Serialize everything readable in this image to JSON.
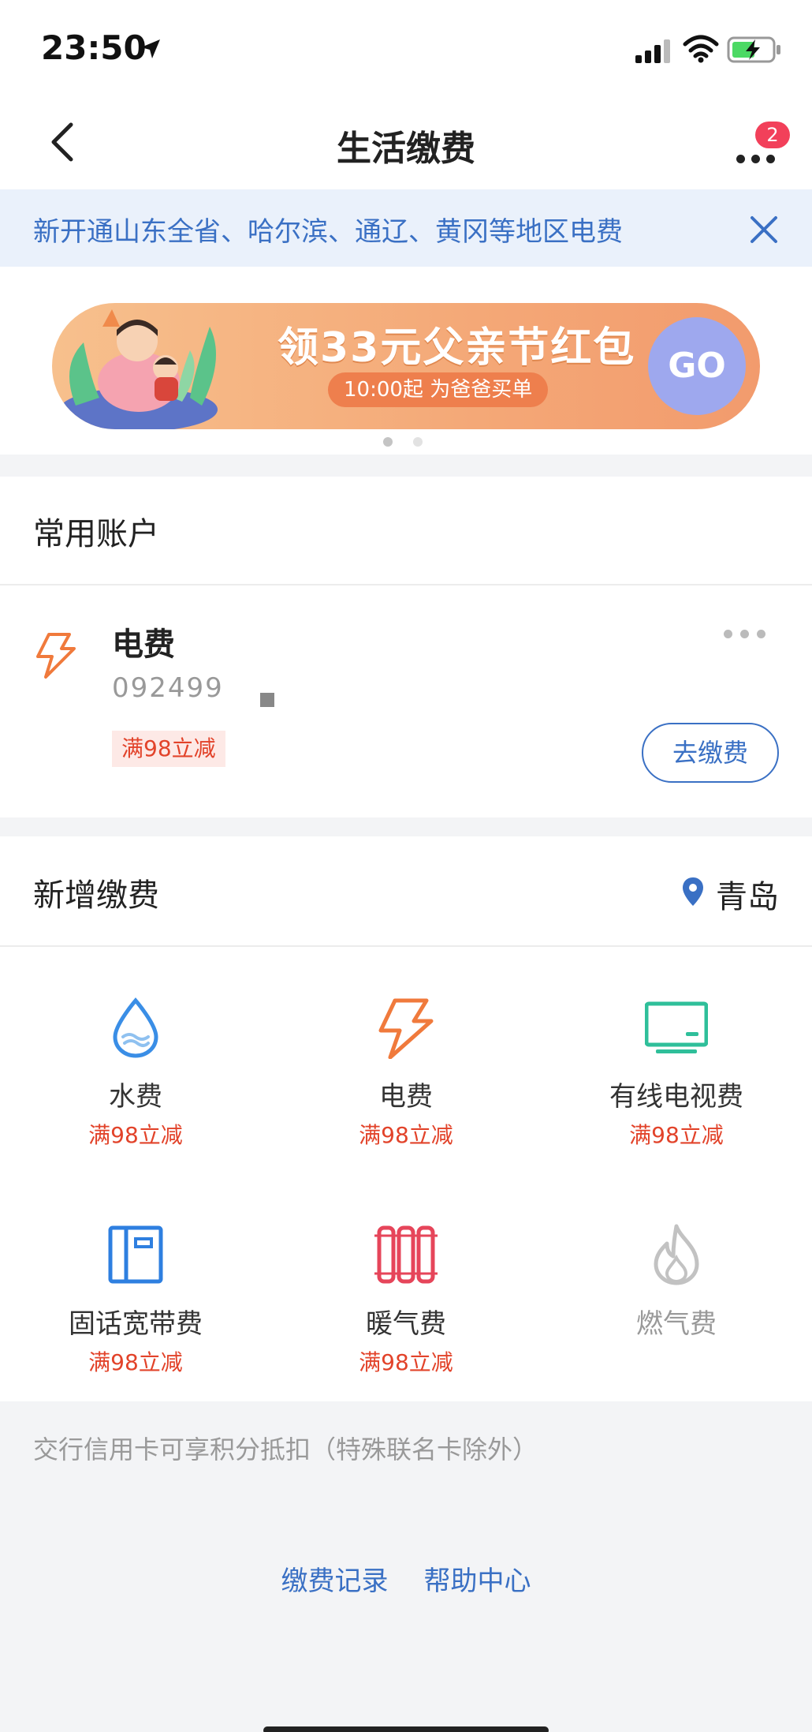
{
  "status_bar": {
    "time": "23:50",
    "icons": [
      "location-arrow-icon",
      "signal-icon",
      "wifi-icon",
      "battery-charging-icon"
    ]
  },
  "nav": {
    "title": "生活缴费",
    "back_icon": "chevron-left-icon",
    "more_icon": "more-dots-icon",
    "badge_count": "2"
  },
  "notice": {
    "text": "新开通山东全省、哈尔滨、通辽、黄冈等地区电费",
    "close_icon": "close-icon"
  },
  "banner": {
    "title": "领33元父亲节红包",
    "subtitle": "10:00起 为爸爸买单",
    "go_label": "GO",
    "page_count": 2,
    "active_page": 1
  },
  "common_accounts": {
    "title": "常用账户",
    "items": [
      {
        "name": "电费",
        "icon": "lightning-icon",
        "account_number": "092499",
        "promo": "满98立减",
        "pay_label": "去缴费"
      }
    ]
  },
  "new_payment": {
    "title": "新增缴费",
    "city": "青岛",
    "city_icon": "location-pin-icon",
    "items": [
      {
        "label": "水费",
        "promo": "满98立减",
        "icon": "water-drop-icon",
        "enabled": true
      },
      {
        "label": "电费",
        "promo": "满98立减",
        "icon": "lightning-icon",
        "enabled": true
      },
      {
        "label": "有线电视费",
        "promo": "满98立减",
        "icon": "tv-icon",
        "enabled": true
      },
      {
        "label": "固话宽带费",
        "promo": "满98立减",
        "icon": "phone-broadband-icon",
        "enabled": true
      },
      {
        "label": "暖气费",
        "promo": "满98立减",
        "icon": "radiator-icon",
        "enabled": true
      },
      {
        "label": "燃气费",
        "promo": "",
        "icon": "flame-icon",
        "enabled": false
      }
    ]
  },
  "footer": {
    "note": "交行信用卡可享积分抵扣（特殊联名卡除外）",
    "links": [
      "缴费记录",
      "帮助中心"
    ]
  },
  "colors": {
    "accent_blue": "#3a70c4",
    "promo_red": "#e2432a",
    "badge_red": "#f2405a",
    "notice_bg": "#eaf1fb",
    "electric_orange": "#f07a3c",
    "tv_green": "#2fbf9a",
    "radiator_red": "#e6455a"
  }
}
